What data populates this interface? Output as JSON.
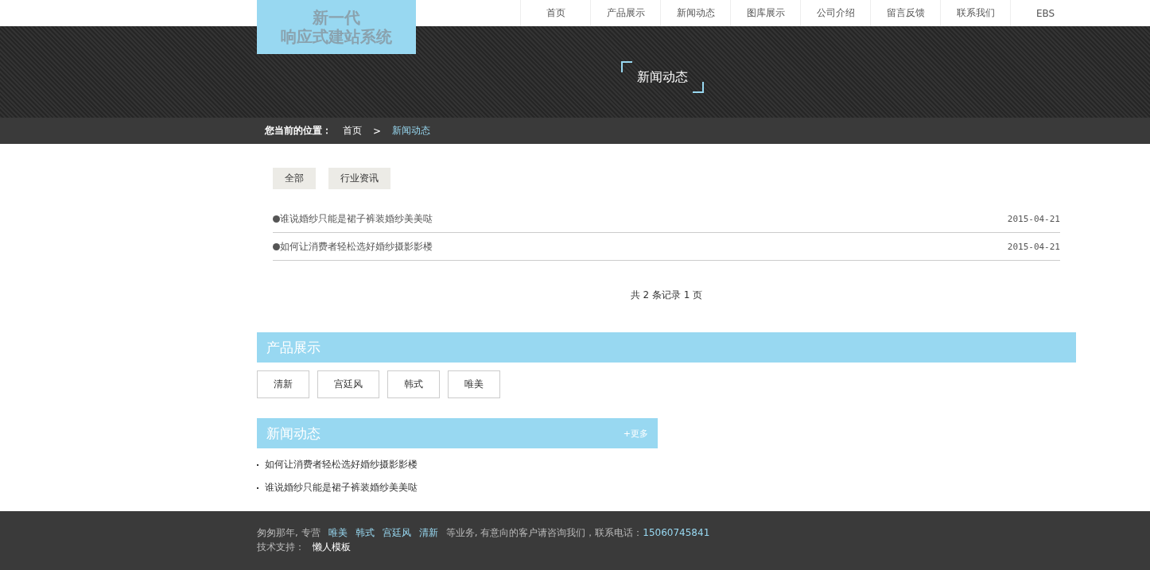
{
  "logo": {
    "line_1": "新一代",
    "line_2": "响应式建站系统"
  },
  "nav": [
    {
      "label": "首页",
      "selected": false
    },
    {
      "label": "产品展示",
      "selected": false
    },
    {
      "label": "新闻动态",
      "selected": false
    },
    {
      "label": "图库展示",
      "selected": false
    },
    {
      "label": "公司介绍",
      "selected": false
    },
    {
      "label": "留言反馈",
      "selected": false
    },
    {
      "label": "联系我们",
      "selected": false
    },
    {
      "label": "EBS",
      "selected": false
    }
  ],
  "banner": {
    "title": "新闻动态"
  },
  "breadcrumb": {
    "label": "您当前的位置：",
    "items": [
      "首页",
      "新闻动态"
    ],
    "separator": ">"
  },
  "filters": [
    {
      "label": "全部",
      "selected": false
    },
    {
      "label": "行业资讯",
      "selected": false
    }
  ],
  "news_list": [
    {
      "title": "谁说婚纱只能是裙子裤装婚纱美美哒",
      "date": "2015-04-21"
    },
    {
      "title": "如何让消费者轻松选好婚纱摄影影楼",
      "date": "2015-04-21"
    }
  ],
  "pagination": "共 2 条记录 1 页",
  "products": {
    "title": "产品展示",
    "tags": [
      "清新",
      "宫廷风",
      "韩式",
      "唯美"
    ]
  },
  "news": {
    "title": "新闻动态",
    "more": "+更多",
    "items": [
      "如何让消费者轻松选好婚纱摄影影楼",
      "谁说婚纱只能是裙子裤装婚纱美美哒"
    ]
  },
  "footer": {
    "text_before": "匆匆那年, 专营",
    "links": [
      "唯美",
      "韩式",
      "宫廷风",
      "清新"
    ],
    "text_after": "等业务, 有意向的客户请咨询我们，联系电话：",
    "phone": "15060745841",
    "support_label": "技术支持：",
    "support_link": "懒人模板"
  }
}
